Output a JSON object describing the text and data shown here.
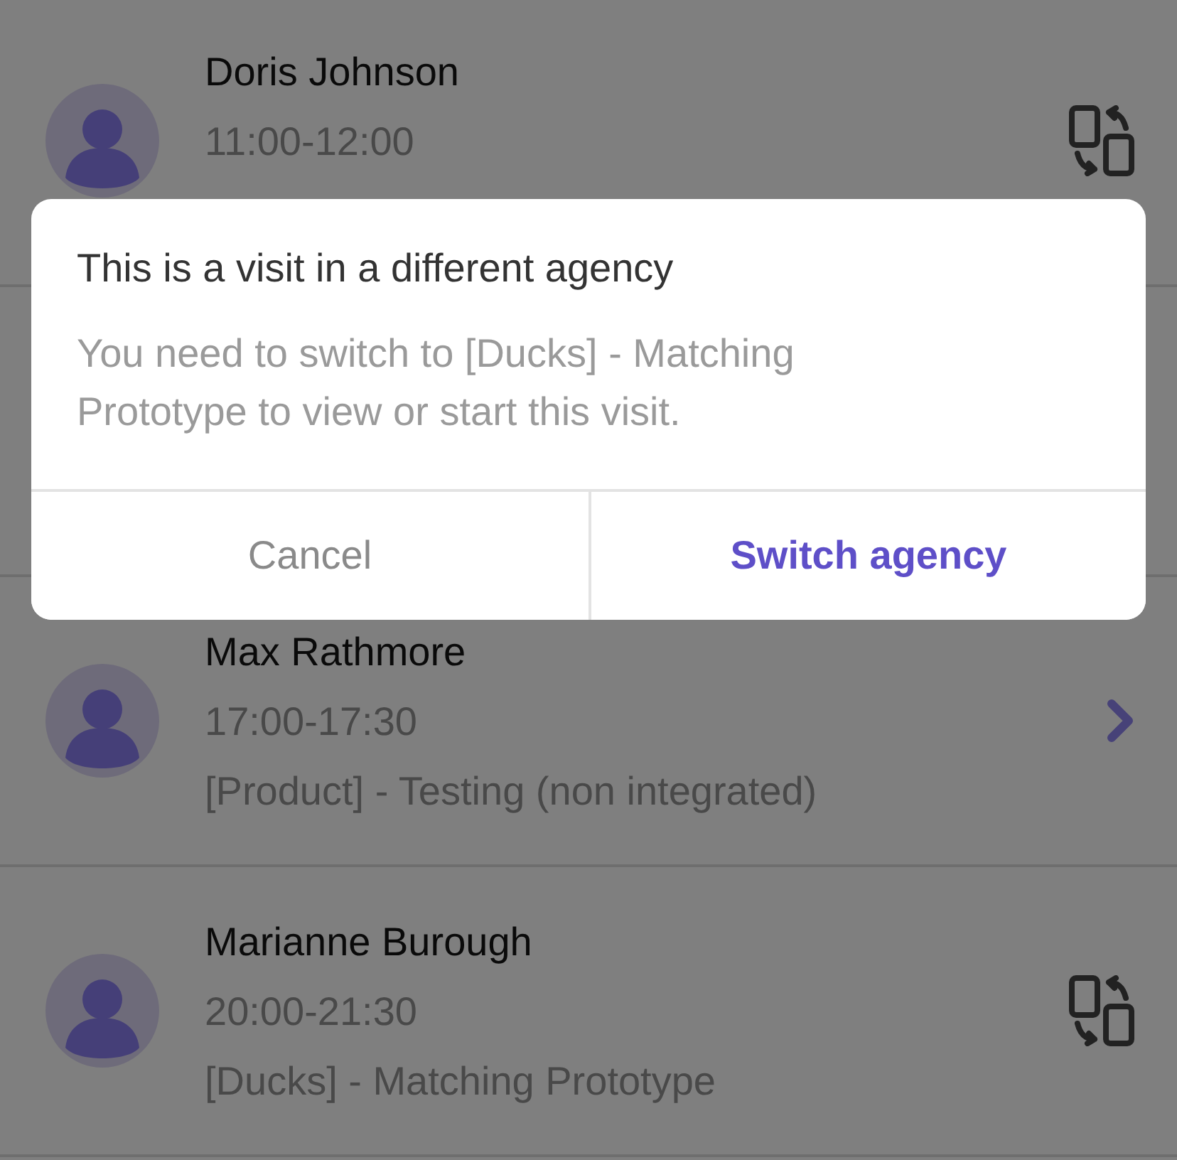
{
  "visits": [
    {
      "name": "Doris Johnson",
      "time": "11:00-12:00",
      "kind": "switch"
    },
    {
      "kind": "hidden"
    },
    {
      "name": "Max Rathmore",
      "time": "17:00-17:30",
      "agency": "[Product] - Testing (non integrated)",
      "kind": "open"
    },
    {
      "name": "Marianne Burough",
      "time": "20:00-21:30",
      "agency": "[Ducks] - Matching Prototype",
      "kind": "switch"
    }
  ],
  "dialog": {
    "title": "This is a visit in a different agency",
    "message": "You need to switch to [Ducks] - Matching Prototype to view or start this visit.",
    "buttons": [
      {
        "label": "Cancel",
        "kind": "secondary"
      },
      {
        "label": "Switch agency",
        "kind": "primary"
      }
    ]
  }
}
